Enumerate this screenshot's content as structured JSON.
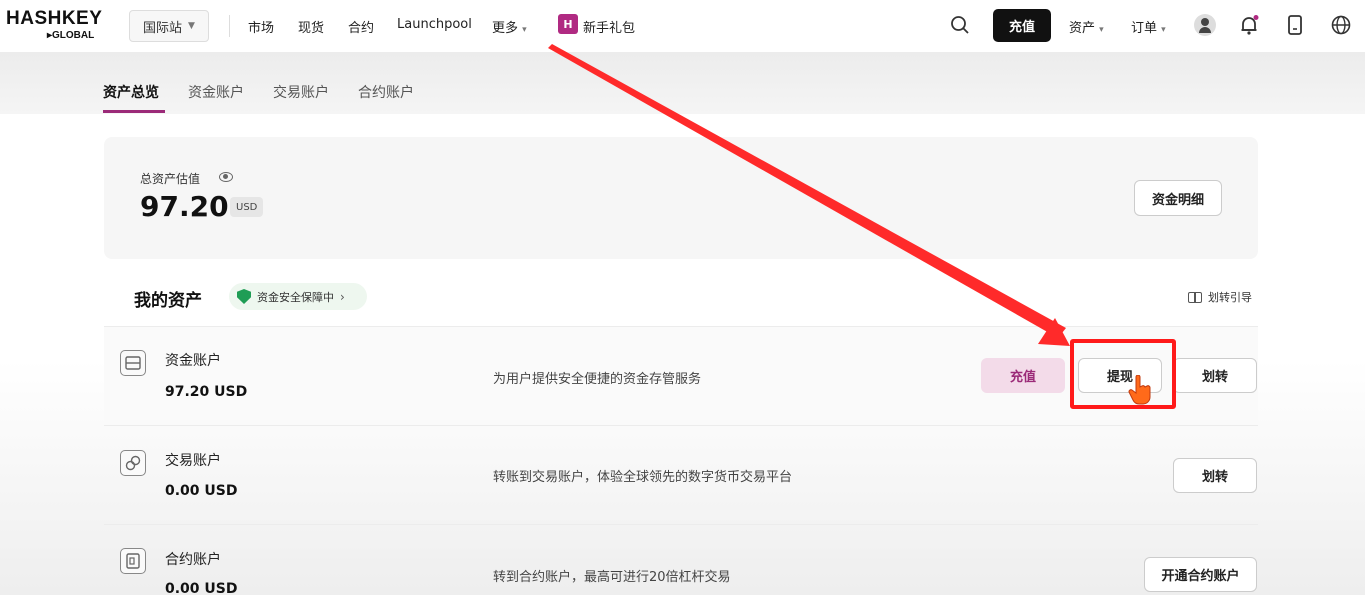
{
  "nav": {
    "brand": "HASHKEY",
    "brand_sub": "▸GLOBAL",
    "region": "国际站",
    "items": [
      "市场",
      "现货",
      "合约",
      "Launchpool",
      "更多"
    ],
    "gift_icon_text": "H",
    "gift_label": "新手礼包",
    "deposit": "充值",
    "assets": "资产",
    "orders": "订单",
    "icons": [
      "search-icon",
      "avatar",
      "bell-icon",
      "download-icon",
      "globe-icon"
    ]
  },
  "subnav": {
    "tabs": [
      "资产总览",
      "资金账户",
      "交易账户",
      "合约账户"
    ],
    "active_index": 0
  },
  "total": {
    "label": "总资产估值",
    "value": "97.20",
    "unit": "USD",
    "detail_button": "资金明细"
  },
  "my_assets": {
    "title": "我的资产",
    "safety_badge": "资金安全保障中",
    "guide": "划转引导"
  },
  "accounts": [
    {
      "name": "资金账户",
      "balance": "97.20 USD",
      "description": "为用户提供安全便捷的资金存管服务",
      "buttons": [
        "充值",
        "提现",
        "划转"
      ]
    },
    {
      "name": "交易账户",
      "balance": "0.00 USD",
      "description": "转账到交易账户，体验全球领先的数字货币交易平台",
      "buttons": [
        "划转"
      ]
    },
    {
      "name": "合约账户",
      "balance": "0.00 USD",
      "description": "转到合约账户，最高可进行20倍杠杆交易",
      "buttons": [
        "开通合约账户"
      ]
    }
  ],
  "colors": {
    "accent": "#9b2a78",
    "annotation_red": "#ff1a1a",
    "shield_green": "#1f9d55"
  }
}
